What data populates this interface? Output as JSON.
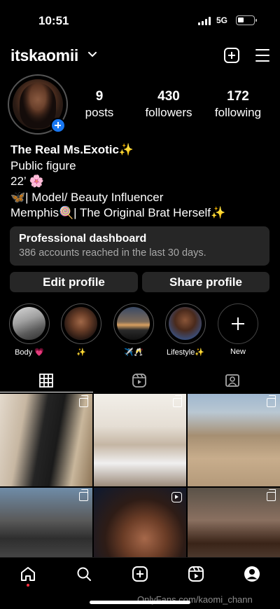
{
  "status_bar": {
    "time": "10:51",
    "network": "5G"
  },
  "header": {
    "username": "itskaomii"
  },
  "stats": [
    {
      "num": "9",
      "label": "posts"
    },
    {
      "num": "430",
      "label": "followers"
    },
    {
      "num": "172",
      "label": "following"
    }
  ],
  "bio": {
    "name": "The Real Ms.Exotic✨",
    "category": "Public figure",
    "line1": "22’ 🌸",
    "line2": "🦋| Model/ Beauty Influencer",
    "line3": "Memphis🍭| The Original Brat Herself✨"
  },
  "dashboard": {
    "title": "Professional dashboard",
    "subtitle": "386 accounts reached in the last 30 days."
  },
  "buttons": {
    "edit": "Edit profile",
    "share": "Share profile"
  },
  "highlights": [
    {
      "caption": "Body 💗"
    },
    {
      "caption": "✨"
    },
    {
      "caption": "✈️🥂"
    },
    {
      "caption": "Lifestyle✨"
    },
    {
      "caption": "New"
    }
  ],
  "tabs": [
    "grid-icon",
    "reels-icon",
    "tagged-icon"
  ],
  "watermark": "OnlyFans.com/kaomi_chann",
  "colors": {
    "background": "#000000",
    "surface": "#262626",
    "accent": "#1877f2",
    "notification": "#ff3040"
  }
}
